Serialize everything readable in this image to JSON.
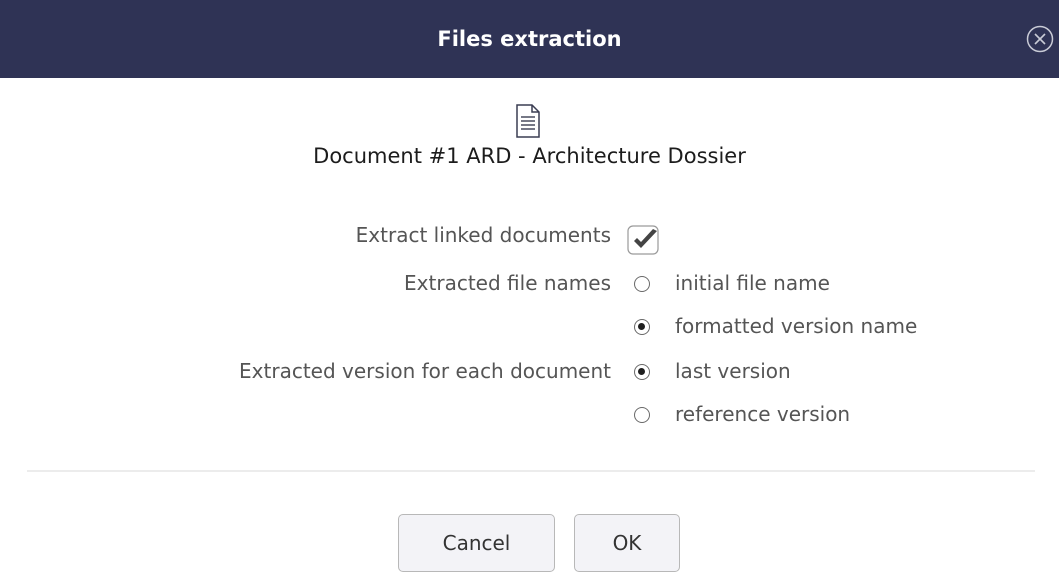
{
  "dialog": {
    "title": "Files extraction",
    "close_icon": "close-circle-icon"
  },
  "document": {
    "icon": "document-icon",
    "name": "Document #1 ARD - Architecture Dossier"
  },
  "options": {
    "extract_linked": {
      "label": "Extract linked documents",
      "checked": true
    },
    "file_names": {
      "label": "Extracted file names",
      "choices": [
        "initial file name",
        "formatted version name"
      ],
      "selected": "formatted version name"
    },
    "version": {
      "label": "Extracted version for each document",
      "choices": [
        "last version",
        "reference version"
      ],
      "selected": "last version"
    }
  },
  "buttons": {
    "cancel": "Cancel",
    "ok": "OK"
  },
  "colors": {
    "titlebar": "#2f3355",
    "label_text": "#555555"
  }
}
